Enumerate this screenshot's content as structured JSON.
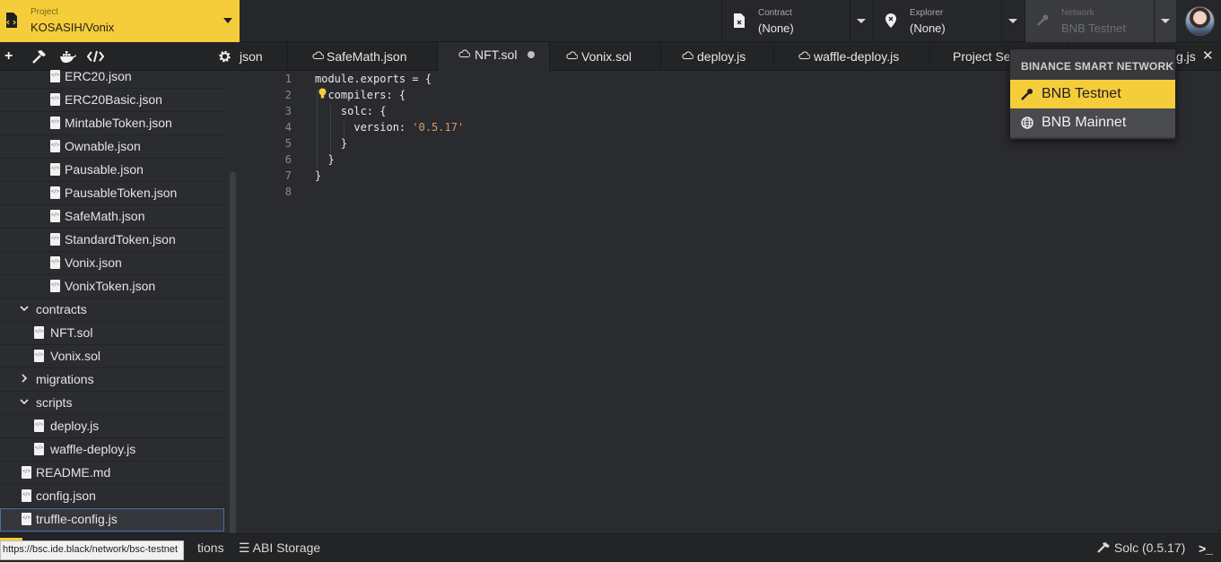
{
  "project": {
    "label": "Project",
    "value": "KOSASIH/Vonix"
  },
  "contract": {
    "label": "Contract",
    "value": "(None)"
  },
  "explorer": {
    "label": "Explorer",
    "value": "(None)"
  },
  "network": {
    "label": "Network",
    "value": "BNB Testnet"
  },
  "tree": [
    {
      "name": "ERC20.json",
      "type": "file"
    },
    {
      "name": "ERC20Basic.json",
      "type": "file"
    },
    {
      "name": "MintableToken.json",
      "type": "file"
    },
    {
      "name": "Ownable.json",
      "type": "file"
    },
    {
      "name": "Pausable.json",
      "type": "file"
    },
    {
      "name": "PausableToken.json",
      "type": "file"
    },
    {
      "name": "SafeMath.json",
      "type": "file"
    },
    {
      "name": "StandardToken.json",
      "type": "file"
    },
    {
      "name": "Vonix.json",
      "type": "file"
    },
    {
      "name": "VonixToken.json",
      "type": "file"
    },
    {
      "name": "contracts",
      "type": "folder-open"
    },
    {
      "name": "NFT.sol",
      "type": "file"
    },
    {
      "name": "Vonix.sol",
      "type": "file"
    },
    {
      "name": "migrations",
      "type": "folder-closed"
    },
    {
      "name": "scripts",
      "type": "folder-open"
    },
    {
      "name": "deploy.js",
      "type": "file"
    },
    {
      "name": "waffle-deploy.js",
      "type": "file"
    },
    {
      "name": "README.md",
      "type": "file"
    },
    {
      "name": "config.json",
      "type": "file"
    },
    {
      "name": "truffle-config.js",
      "type": "file"
    }
  ],
  "tabs": [
    {
      "label": "json"
    },
    {
      "label": "SafeMath.json"
    },
    {
      "label": "NFT.sol"
    },
    {
      "label": "Vonix.sol"
    },
    {
      "label": "deploy.js"
    },
    {
      "label": "waffle-deploy.js"
    },
    {
      "label": "Project Se"
    },
    {
      "label": "g.js"
    }
  ],
  "editor": {
    "line_numbers": [
      "1",
      "2",
      "3",
      "4",
      "5",
      "6",
      "7",
      "8"
    ],
    "lines": [
      {
        "code": "module.exports = {"
      },
      {
        "code": "  compilers: {"
      },
      {
        "code": "    solc: {"
      },
      {
        "code": "      version: ",
        "str": "'0.5.17'"
      },
      {
        "code": "    }"
      },
      {
        "code": "  }"
      },
      {
        "code": "}"
      },
      {
        "code": ""
      }
    ]
  },
  "network_dropdown": {
    "header": "BINANCE SMART NETWORK",
    "items": [
      {
        "label": "BNB Testnet",
        "icon": "key-icon"
      },
      {
        "label": "BNB Mainnet",
        "icon": "globe-icon"
      }
    ]
  },
  "statusbar": {
    "left_partial": "tions",
    "abi_storage": "ABI Storage",
    "compiler": "Solc (0.5.17)",
    "url_tooltip": "https://bsc.ide.black/network/bsc-testnet"
  },
  "colors": {
    "accent": "#f5cd3a",
    "background": "#2a2b2e",
    "string": "#d69b6b"
  }
}
